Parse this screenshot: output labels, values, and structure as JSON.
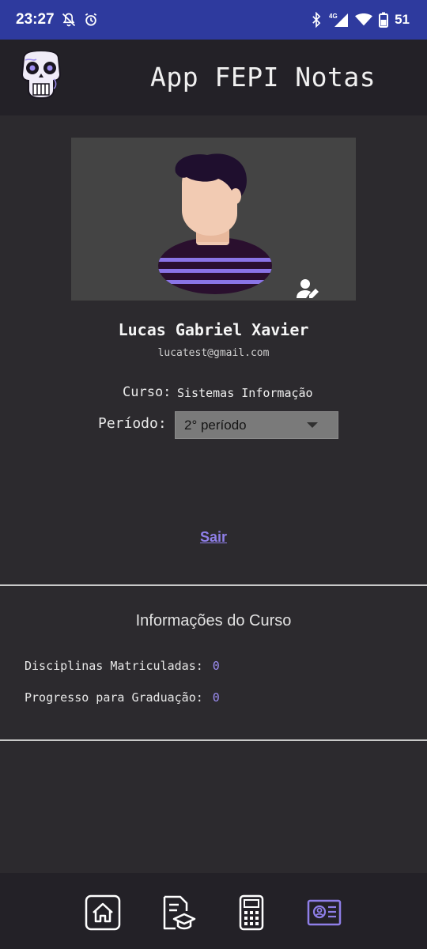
{
  "status_bar": {
    "time": "23:27",
    "network_label": "4G",
    "battery": "51"
  },
  "header": {
    "title": "App FEPI Notas"
  },
  "profile": {
    "name": "Lucas Gabriel Xavier",
    "email": "lucatest@gmail.com",
    "curso_label": "Curso:",
    "curso_value": "Sistemas Informação",
    "periodo_label": "Período:",
    "periodo_value": "2° período",
    "logout_label": "Sair"
  },
  "course_info": {
    "title": "Informações do Curso",
    "disciplinas_label": "Disciplinas Matriculadas:",
    "disciplinas_value": "0",
    "progresso_label": "Progresso para Graduação:",
    "progresso_value": "0"
  },
  "bottom_nav": {
    "items": [
      {
        "icon": "home-icon",
        "active": false
      },
      {
        "icon": "grades-document-icon",
        "active": false
      },
      {
        "icon": "calculator-icon",
        "active": false
      },
      {
        "icon": "profile-card-icon",
        "active": true
      }
    ]
  },
  "colors": {
    "status_bar": "#2e3a9e",
    "background": "#2c2a2e",
    "header": "#232127",
    "accent": "#8f7fe8",
    "inactive_icon": "#ffffff"
  }
}
